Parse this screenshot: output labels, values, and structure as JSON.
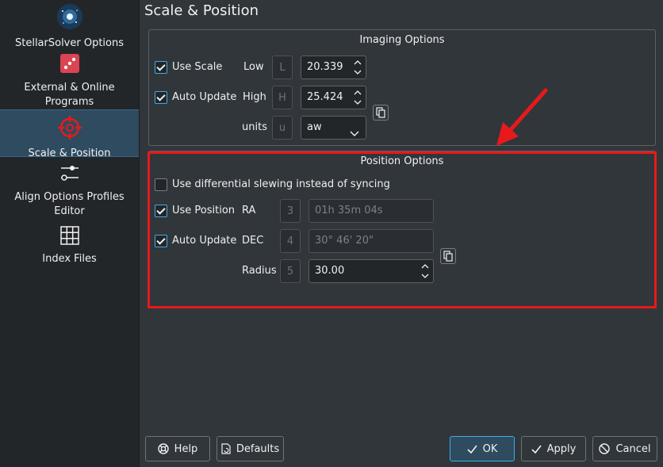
{
  "sidebar": {
    "items": [
      {
        "label": "StellarSolver Options",
        "icon": "galaxy-icon"
      },
      {
        "label": "External & Online Programs",
        "icon": "dice-icon"
      },
      {
        "label": "Scale & Position",
        "icon": "crosshair-icon"
      },
      {
        "label": "Align Options Profiles Editor",
        "icon": "slider-icon"
      },
      {
        "label": "Index Files",
        "icon": "grid-icon"
      }
    ],
    "selected": "Scale & Position"
  },
  "page_title": "Scale & Position",
  "imaging": {
    "title": "Imaging Options",
    "use_scale_label": "Use Scale",
    "use_scale_checked": true,
    "auto_update_label": "Auto Update",
    "auto_update_checked": true,
    "low_label": "Low",
    "low_key": "L",
    "low_value": "20.339",
    "high_label": "High",
    "high_key": "H",
    "high_value": "25.424",
    "units_label": "units",
    "units_key": "u",
    "units_value": "aw"
  },
  "position": {
    "title": "Position Options",
    "differential_label": "Use differential slewing instead of syncing",
    "differential_checked": false,
    "use_position_label": "Use Position",
    "use_position_checked": true,
    "auto_update_label": "Auto Update",
    "auto_update_checked": true,
    "ra_label": "RA",
    "ra_key": "3",
    "ra_value": "01h 35m 04s",
    "dec_label": "DEC",
    "dec_key": "4",
    "dec_value": "30° 46' 20\"",
    "radius_label": "Radius",
    "radius_key": "5",
    "radius_value": "30.00"
  },
  "buttons": {
    "help": "Help",
    "defaults": "Defaults",
    "ok": "OK",
    "apply": "Apply",
    "cancel": "Cancel"
  },
  "colors": {
    "accent": "#3daee9",
    "annotation_red": "#e8191b",
    "background": "#31363b",
    "sidebar": "#232629"
  }
}
